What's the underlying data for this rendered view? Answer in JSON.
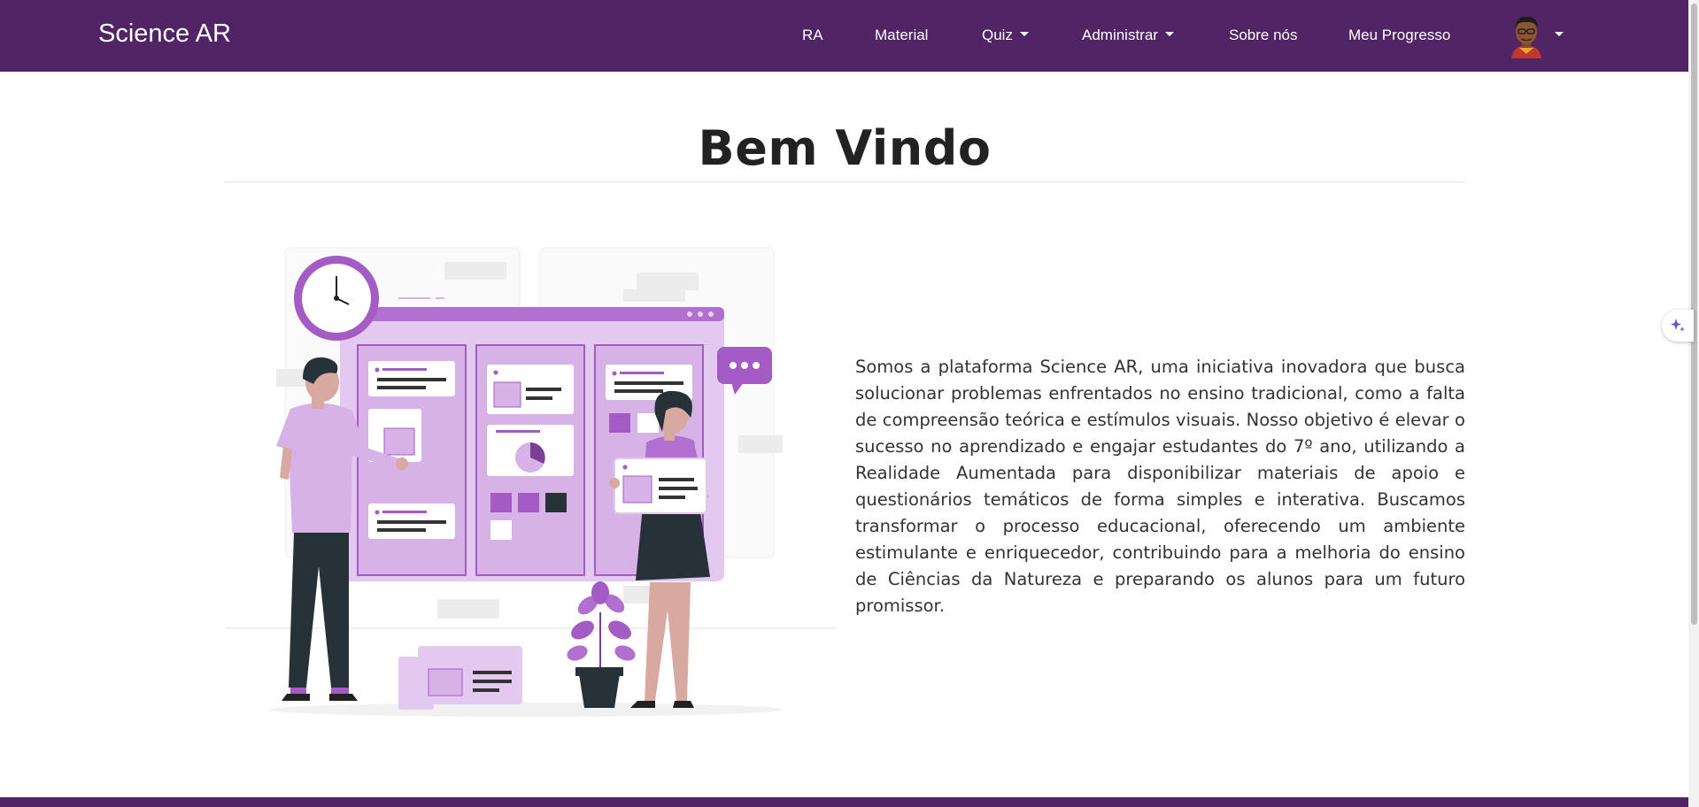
{
  "navbar": {
    "brand": "Science AR",
    "links": {
      "ra": "RA",
      "material": "Material",
      "quiz": "Quiz",
      "administrar": "Administrar",
      "sobre": "Sobre nós",
      "progresso": "Meu Progresso"
    }
  },
  "main": {
    "title": "Bem Vindo",
    "intro": "Somos a plataforma Science AR, uma iniciativa inovadora que busca solucionar problemas enfrentados no ensino tradicional, como a falta de compreensão teórica e estímulos visuais. Nosso objetivo é elevar o sucesso no aprendizado e engajar estudantes do 7º ano, utilizando a Realidade Aumentada para disponibilizar materiais de apoio e questionários temáticos de forma simples e interativa. Buscamos transformar o processo educacional, oferecendo um ambiente estimulante e enriquecedor, contribuindo para a melhoria do ensino de Ciências da Natureza e preparando os alunos para um futuro promissor."
  },
  "colors": {
    "navbar": "#512465",
    "accent": "#a45cc4",
    "light_accent": "#dcbde9"
  },
  "icons": {
    "avatar": "user-avatar",
    "dropdown": "caret-down-icon",
    "side_action": "sparkle-icon"
  }
}
